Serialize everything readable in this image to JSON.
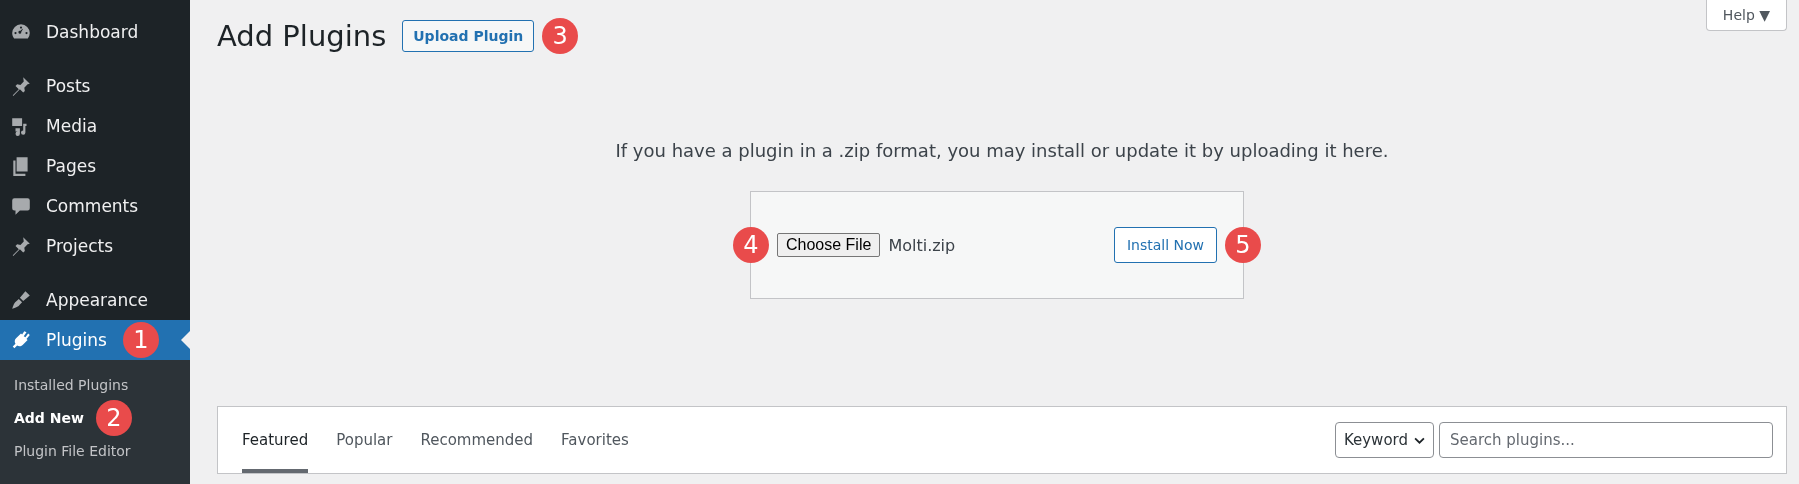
{
  "sidebar": {
    "groups": [
      {
        "items": [
          {
            "label": "Dashboard",
            "kind": "gauge",
            "selected": false
          }
        ]
      },
      {
        "items": [
          {
            "label": "Posts",
            "kind": "pin",
            "selected": false
          },
          {
            "label": "Media",
            "kind": "media",
            "selected": false
          },
          {
            "label": "Pages",
            "kind": "pages",
            "selected": false
          },
          {
            "label": "Comments",
            "kind": "comment",
            "selected": false
          },
          {
            "label": "Projects",
            "kind": "pin",
            "selected": false
          }
        ]
      },
      {
        "items": [
          {
            "label": "Appearance",
            "kind": "brush",
            "selected": false
          },
          {
            "label": "Plugins",
            "kind": "plug",
            "selected": true,
            "callout": "1",
            "children": [
              {
                "label": "Installed Plugins",
                "selected": false
              },
              {
                "label": "Add New",
                "selected": true,
                "callout": "2"
              },
              {
                "label": "Plugin File Editor",
                "selected": false
              }
            ]
          }
        ]
      }
    ]
  },
  "help_button": {
    "label": "Help ▼"
  },
  "header": {
    "title": "Add Plugins",
    "button": {
      "label": "Upload Plugin",
      "callout": "3"
    }
  },
  "upload": {
    "message": "If you have a plugin in a .zip format, you may install or update it by uploading it here.",
    "file_button": {
      "label": "Choose File",
      "callout": "4"
    },
    "file_name": "Molti.zip",
    "install_button": {
      "label": "Install Now",
      "callout": "5"
    }
  },
  "filter_bar": {
    "tabs": [
      {
        "label": "Featured",
        "selected": true
      },
      {
        "label": "Popular",
        "selected": false
      },
      {
        "label": "Recommended",
        "selected": false
      },
      {
        "label": "Favorites",
        "selected": false
      }
    ],
    "search_type": {
      "value": "Keyword"
    },
    "search": {
      "placeholder": "Search plugins..."
    }
  }
}
